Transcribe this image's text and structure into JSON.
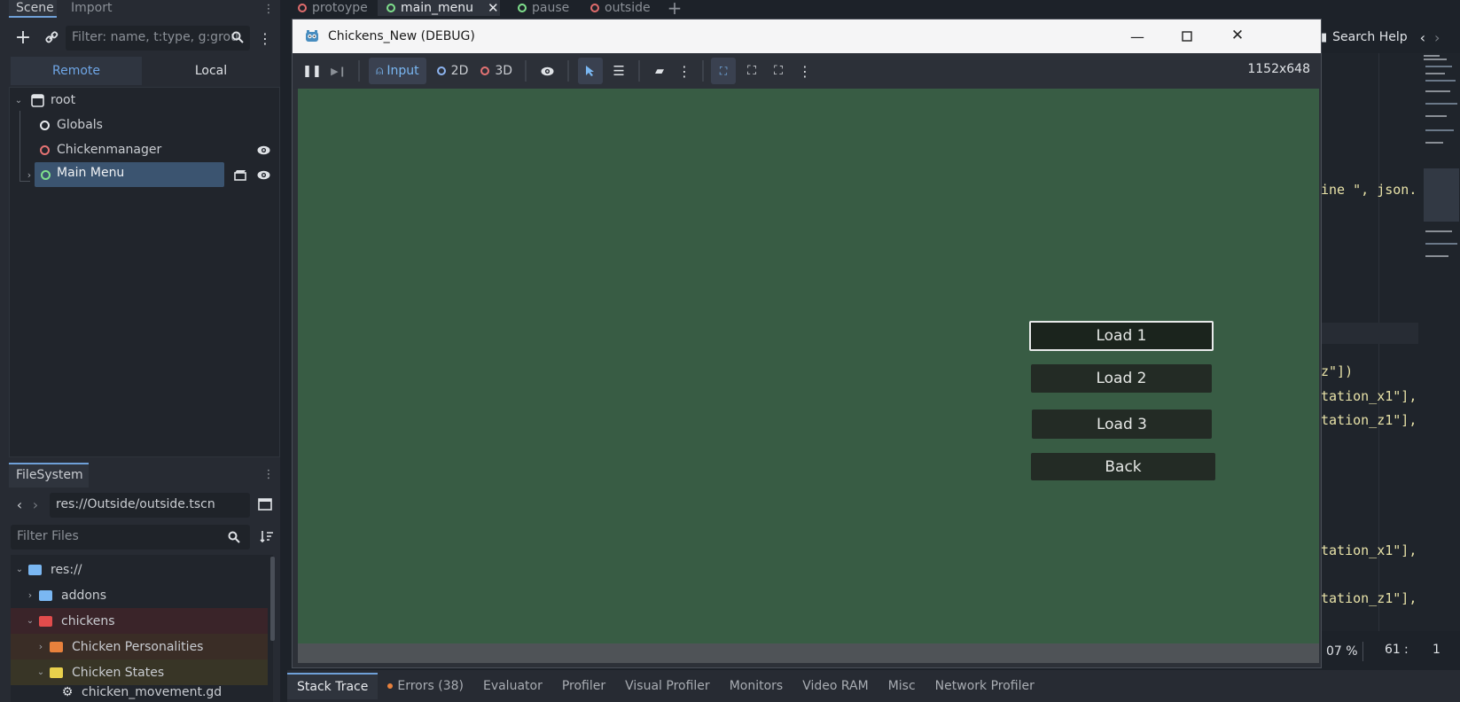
{
  "scene_dock": {
    "tabs": [
      "Scene",
      "Import"
    ],
    "filter_placeholder": "Filter: name, t:type, g:grou",
    "remote_label": "Remote",
    "local_label": "Local",
    "tree": [
      {
        "label": "root",
        "icon": "node-icon"
      },
      {
        "label": "Globals",
        "icon": "circle-node-icon"
      },
      {
        "label": "Chickenmanager",
        "icon": "circle-node-icon"
      },
      {
        "label": "Main Menu",
        "icon": "circle-node-icon"
      }
    ]
  },
  "filesystem": {
    "title": "FileSystem",
    "path": "res://Outside/outside.tscn",
    "filter_placeholder": "Filter Files",
    "items": [
      {
        "label": "res://",
        "color": "#7ab7f2"
      },
      {
        "label": "addons",
        "color": "#7ab7f2"
      },
      {
        "label": "chickens",
        "color": "#e24c4c"
      },
      {
        "label": "Chicken Personalities",
        "color": "#e8813c"
      },
      {
        "label": "Chicken States",
        "color": "#e8d04c"
      },
      {
        "label": "chicken_movement.gd",
        "color": "#c9ccd1"
      }
    ]
  },
  "editor_tabs": [
    {
      "label": "protoype",
      "color": "#e06c6c"
    },
    {
      "label": "main_menu",
      "color": "#7fe08c"
    },
    {
      "label": "pause",
      "color": "#7fe08c"
    },
    {
      "label": "outside",
      "color": "#e06c6c"
    }
  ],
  "right_panel": {
    "search_help": "Search Help",
    "zoom": "07 %",
    "cursor_line": "61",
    "cursor_col": "1",
    "code_lines": [
      "ine \", json.",
      "z\"])",
      "tation_x1\"],",
      "tation_z1\"],",
      "tation_x1\"],",
      "tation_z1\"],"
    ]
  },
  "game_window": {
    "title": "Chickens_New (DEBUG)",
    "toolbar": {
      "input_label": "Input",
      "two_d_label": "2D",
      "three_d_label": "3D",
      "resolution": "1152x648"
    },
    "buttons": [
      "Load 1",
      "Load 2",
      "Load 3",
      "Back"
    ]
  },
  "bottom_tabs": [
    "Stack Trace",
    "Errors (38)",
    "Evaluator",
    "Profiler",
    "Visual Profiler",
    "Monitors",
    "Video RAM",
    "Misc",
    "Network Profiler"
  ],
  "colors": {
    "viewport_bg": "#385c44",
    "button_bg": "#232b25",
    "accent": "#4a7fb8"
  }
}
